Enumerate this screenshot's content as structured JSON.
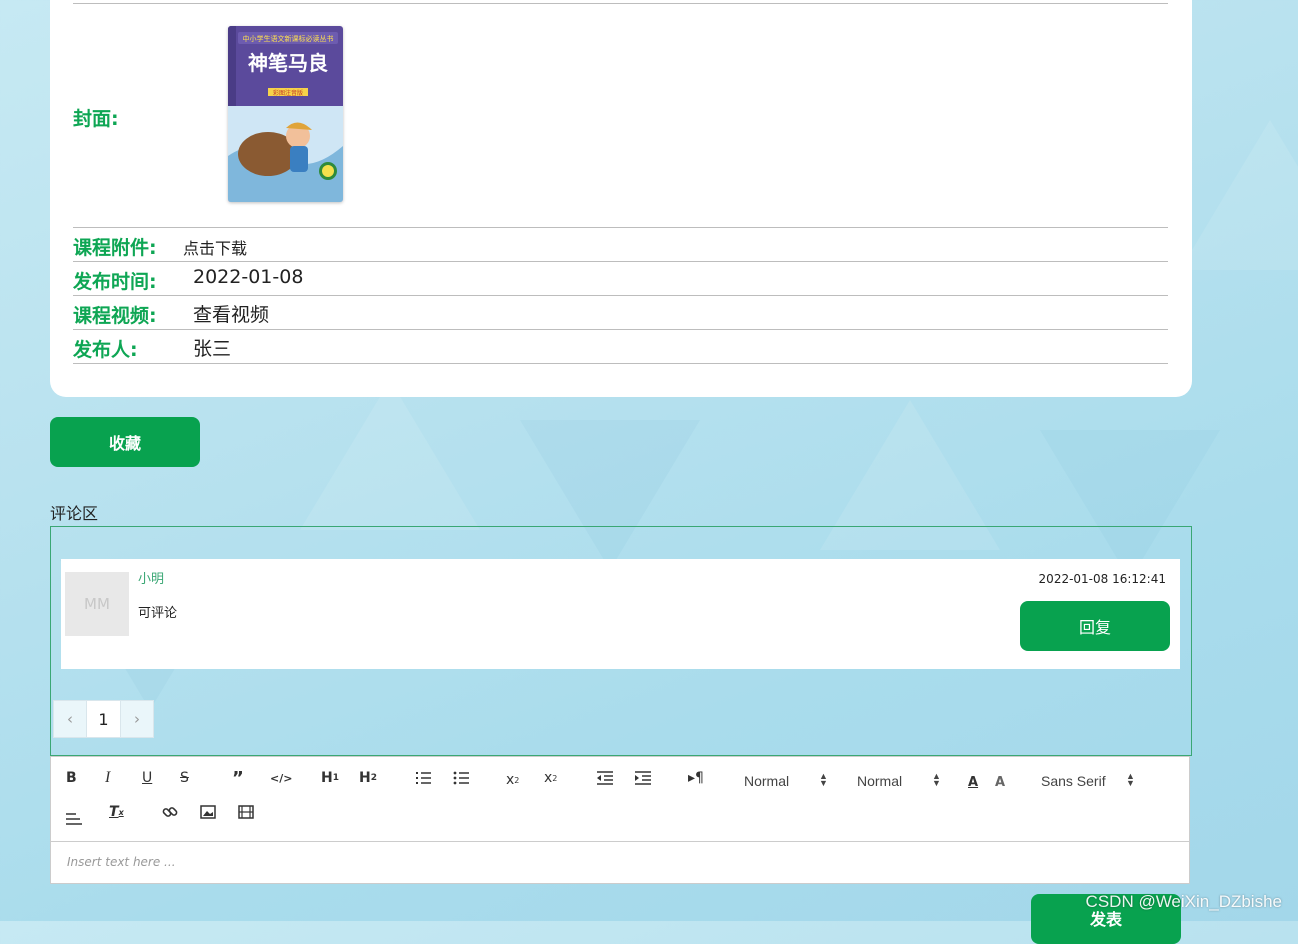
{
  "details": {
    "cover_label": "封面:",
    "rows": [
      {
        "label": "课程附件:",
        "value": "点击下载"
      },
      {
        "label": "发布时间:",
        "value": "2022-01-08"
      },
      {
        "label": "课程视频:",
        "value": "查看视频"
      },
      {
        "label": "发布人:",
        "value": "张三"
      }
    ]
  },
  "cover_book": {
    "title": "神笔马良",
    "series": "中小学生语文新课标必读丛书",
    "edition_badge": "彩图注音版"
  },
  "favorite_button": "收藏",
  "comments": {
    "title": "评论区",
    "items": [
      {
        "avatar": "MM",
        "name": "小明",
        "text": "可评论",
        "time": "2022-01-08 16:12:41",
        "reply_button": "回复"
      }
    ],
    "pagination": {
      "prev": "‹",
      "current": "1",
      "next": "›"
    }
  },
  "editor": {
    "header_select": "Normal",
    "size_select": "Normal",
    "font_select": "Sans Serif",
    "placeholder": "Insert text here ..."
  },
  "submit_button": "发表",
  "watermark": "CSDN @WeiXin_DZbishe",
  "colors": {
    "accent": "#08a24f",
    "label_green": "#0ea654",
    "border_green": "#3aa774"
  }
}
